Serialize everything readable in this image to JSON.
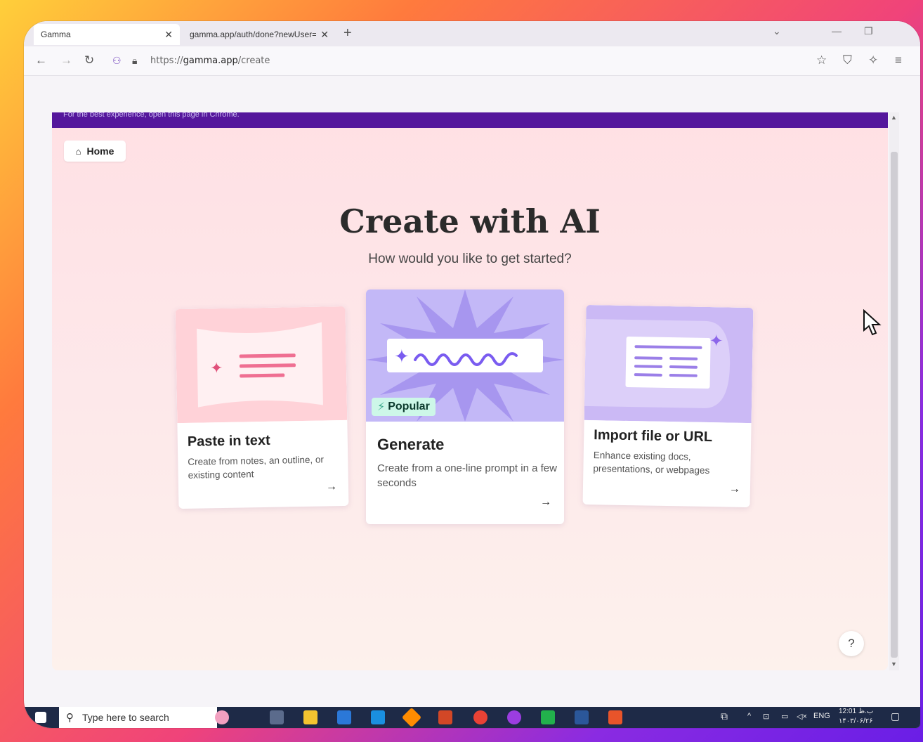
{
  "browser": {
    "tabs": [
      {
        "title": "Gamma",
        "active": true
      },
      {
        "title": "gamma.app/auth/done?newUser=t",
        "active": false
      }
    ],
    "url_prefix": "https://",
    "url_host": "gamma.app",
    "url_path": "/create"
  },
  "page": {
    "banner": "For the best experience, open this page in Chrome.",
    "home_label": "Home",
    "title": "Create with AI",
    "subtitle": "How would you like to get started?",
    "cards": [
      {
        "title": "Paste in text",
        "desc": "Create from notes, an outline, or existing content",
        "arrow": "→"
      },
      {
        "title": "Generate",
        "desc": "Create from a one-line prompt in a few seconds",
        "arrow": "→",
        "badge": "Popular"
      },
      {
        "title": "Import file or URL",
        "desc": "Enhance existing docs, presentations, or webpages",
        "arrow": "→"
      }
    ],
    "help": "?"
  },
  "taskbar": {
    "search_placeholder": "Type here to search",
    "lang": "ENG",
    "time": "12:01 ب.ظ",
    "date": "۱۴۰۳/۰۶/۲۶"
  },
  "colors": {
    "banner": "#55169c",
    "badge": "#cdf7e8",
    "accent": "#7a5cf0"
  }
}
